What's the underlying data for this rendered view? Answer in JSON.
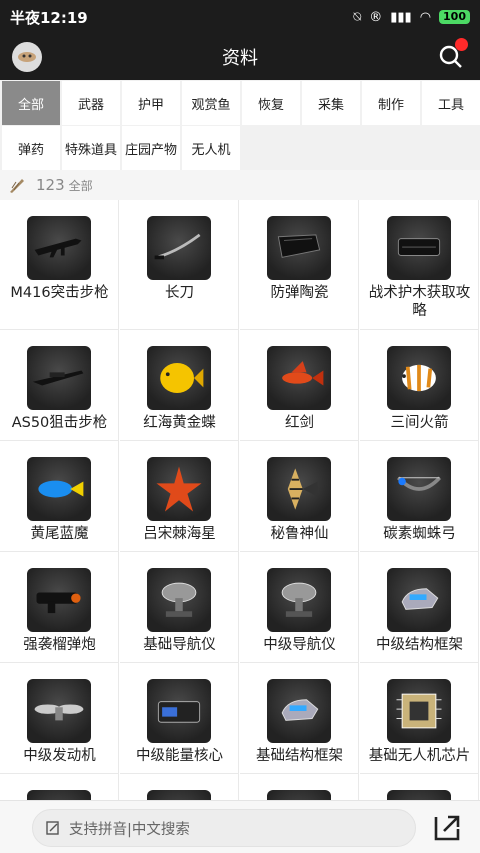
{
  "status": {
    "time": "半夜12:19",
    "battery": "100"
  },
  "appbar": {
    "title": "资料"
  },
  "tabs": [
    "全部",
    "武器",
    "护甲",
    "观赏鱼",
    "恢复",
    "采集",
    "制作",
    "工具",
    "弹药",
    "特殊道具",
    "庄园产物",
    "无人机"
  ],
  "count": {
    "number": "123",
    "label": "全部"
  },
  "items": [
    {
      "name": "M416突击步枪",
      "icon": "rifle-icon"
    },
    {
      "name": "长刀",
      "icon": "blade-icon"
    },
    {
      "name": "防弹陶瓷",
      "icon": "armor-plate-icon"
    },
    {
      "name": "战术护木获取攻略",
      "icon": "handguard-icon"
    },
    {
      "name": "AS50狙击步枪",
      "icon": "sniper-icon"
    },
    {
      "name": "红海黄金蝶",
      "icon": "yellow-fish-icon"
    },
    {
      "name": "红剑",
      "icon": "red-fish-icon"
    },
    {
      "name": "三间火箭",
      "icon": "clown-fish-icon"
    },
    {
      "name": "黄尾蓝魔",
      "icon": "blue-fish-icon"
    },
    {
      "name": "吕宋棘海星",
      "icon": "starfish-icon"
    },
    {
      "name": "秘鲁神仙",
      "icon": "angelfish-icon"
    },
    {
      "name": "碳素蜘蛛弓",
      "icon": "bow-icon"
    },
    {
      "name": "强袭榴弹炮",
      "icon": "grenade-launcher-icon"
    },
    {
      "name": "基础导航仪",
      "icon": "radar-dish-icon"
    },
    {
      "name": "中级导航仪",
      "icon": "radar-dish-icon"
    },
    {
      "name": "中级结构框架",
      "icon": "drone-frame-icon"
    },
    {
      "name": "中级发动机",
      "icon": "propeller-icon"
    },
    {
      "name": "中级能量核心",
      "icon": "battery-icon"
    },
    {
      "name": "基础结构框架",
      "icon": "drone-frame-icon"
    },
    {
      "name": "基础无人机芯片",
      "icon": "chip-icon"
    }
  ],
  "bottom": {
    "search_placeholder": "支持拼音|中文搜索"
  }
}
